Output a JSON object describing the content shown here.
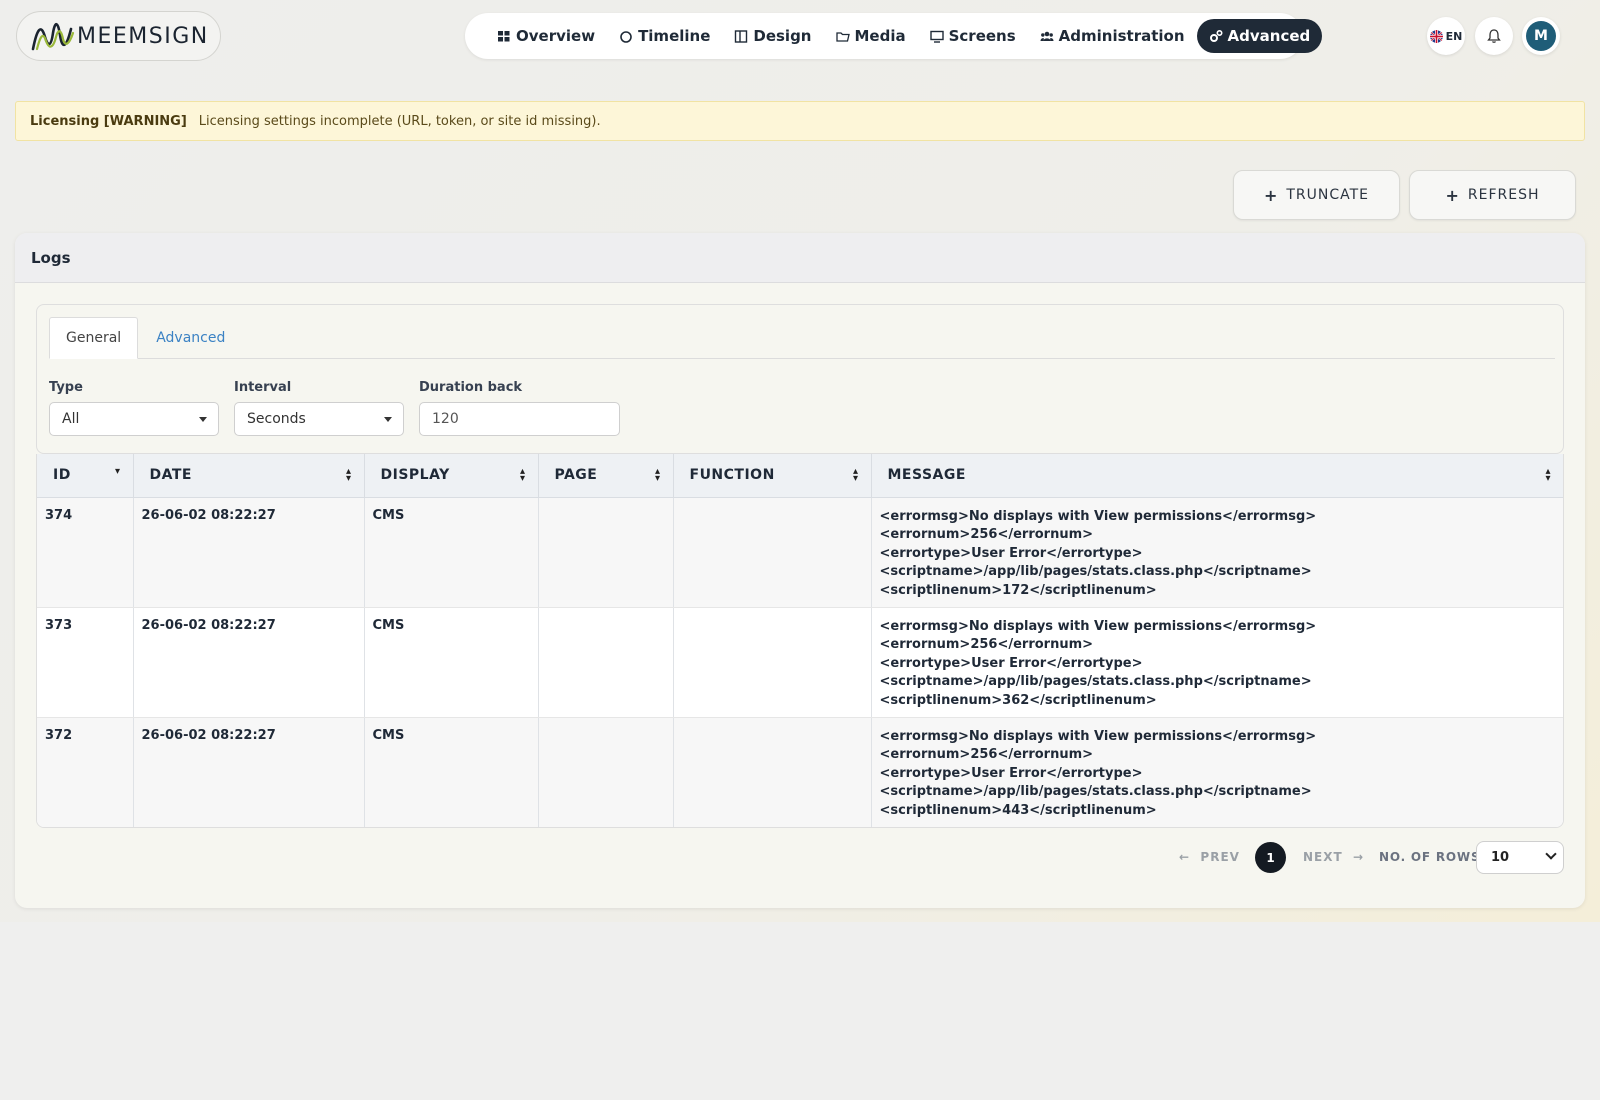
{
  "app": {
    "brand": "MEEMSIGN",
    "accent": "#1f2a37"
  },
  "nav": {
    "items": [
      {
        "label": "Overview",
        "icon": "grid-icon"
      },
      {
        "label": "Timeline",
        "icon": "circle-icon"
      },
      {
        "label": "Design",
        "icon": "layout-icon"
      },
      {
        "label": "Media",
        "icon": "folder-icon"
      },
      {
        "label": "Screens",
        "icon": "monitor-icon"
      },
      {
        "label": "Administration",
        "icon": "users-icon"
      },
      {
        "label": "Advanced",
        "icon": "gears-icon",
        "active": true
      }
    ]
  },
  "header": {
    "lang": "EN",
    "avatar_initial": "M"
  },
  "warning": {
    "title": "Licensing [WARNING]",
    "text": "Licensing settings incomplete (URL, token, or site id missing)."
  },
  "actions": {
    "truncate": "TRUNCATE",
    "refresh": "REFRESH"
  },
  "card": {
    "title": "Logs",
    "tabs": [
      "General",
      "Advanced"
    ],
    "filters": {
      "type_label": "Type",
      "type_value": "All",
      "interval_label": "Interval",
      "interval_value": "Seconds",
      "duration_label": "Duration back",
      "duration_value": "120"
    }
  },
  "table": {
    "columns": [
      "ID",
      "DATE",
      "DISPLAY",
      "PAGE",
      "FUNCTION",
      "MESSAGE"
    ],
    "rows": [
      {
        "id": "374",
        "date": "26-06-02 08:22:27",
        "display": "CMS",
        "page": "",
        "function": "",
        "message": [
          "<errormsg>No displays with View permissions</errormsg>",
          "<errornum>256</errornum>",
          "<errortype>User Error</errortype>",
          "<scriptname>/app/lib/pages/stats.class.php</scriptname>",
          "<scriptlinenum>172</scriptlinenum>"
        ]
      },
      {
        "id": "373",
        "date": "26-06-02 08:22:27",
        "display": "CMS",
        "page": "",
        "function": "",
        "message": [
          "<errormsg>No displays with View permissions</errormsg>",
          "<errornum>256</errornum>",
          "<errortype>User Error</errortype>",
          "<scriptname>/app/lib/pages/stats.class.php</scriptname>",
          "<scriptlinenum>362</scriptlinenum>"
        ]
      },
      {
        "id": "372",
        "date": "26-06-02 08:22:27",
        "display": "CMS",
        "page": "",
        "function": "",
        "message": [
          "<errormsg>No displays with View permissions</errormsg>",
          "<errornum>256</errornum>",
          "<errortype>User Error</errortype>",
          "<scriptname>/app/lib/pages/stats.class.php</scriptname>",
          "<scriptlinenum>443</scriptlinenum>"
        ]
      }
    ]
  },
  "pagination": {
    "prev": "PREV",
    "next": "NEXT",
    "current_page": "1",
    "rows_label": "NO. OF ROWS",
    "rows_value": "10"
  }
}
